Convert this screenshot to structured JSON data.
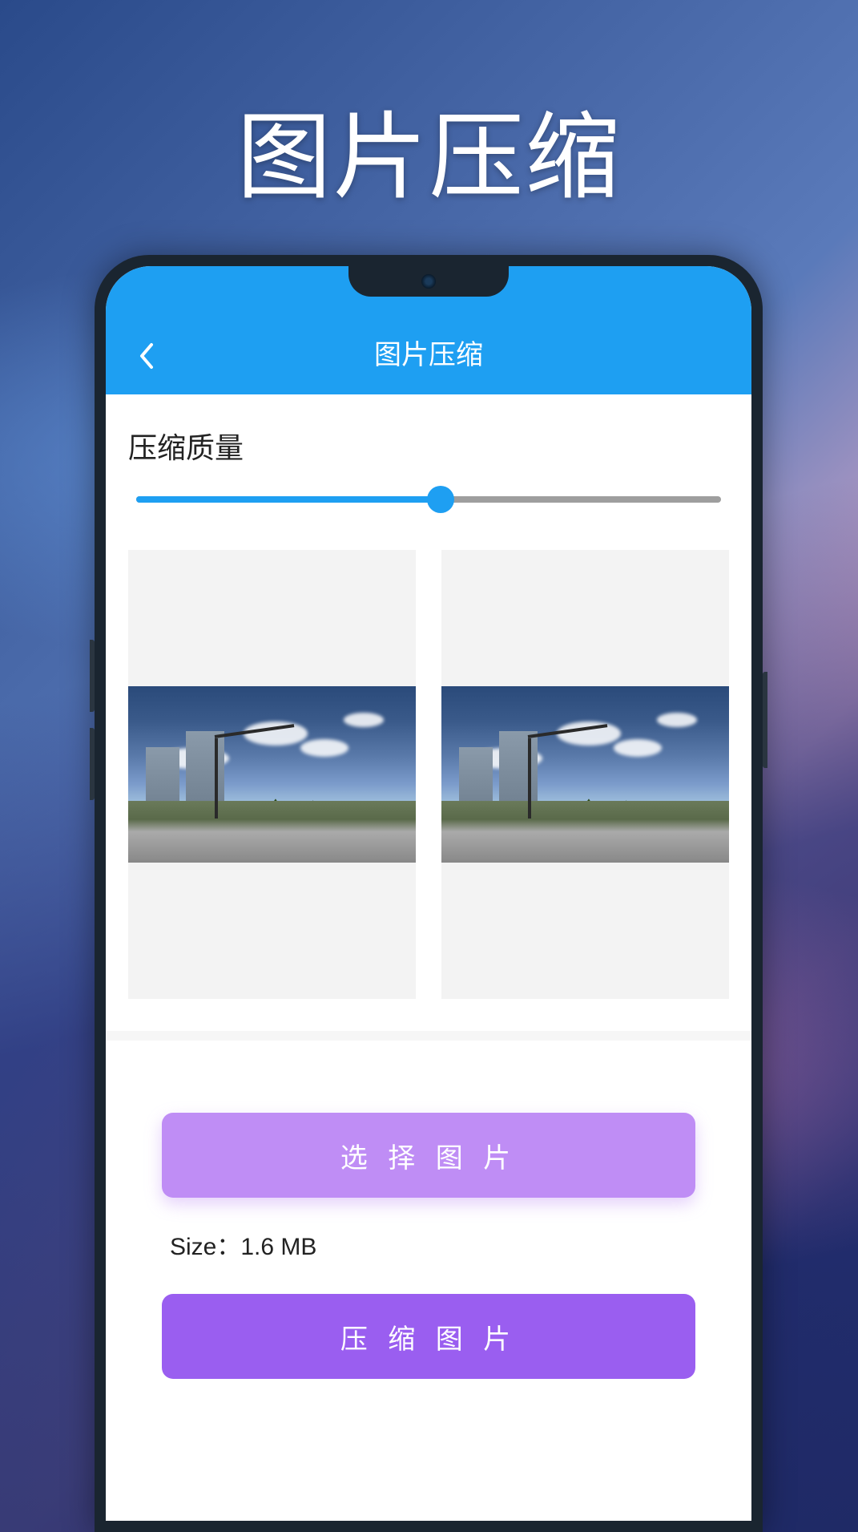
{
  "promo": {
    "title": "图片压缩"
  },
  "header": {
    "title": "图片压缩"
  },
  "quality": {
    "label": "压缩质量",
    "percent": 52
  },
  "size": {
    "label": "Size：1.6 MB"
  },
  "buttons": {
    "select": "选 择 图 片",
    "compress": "压 缩 图 片"
  }
}
